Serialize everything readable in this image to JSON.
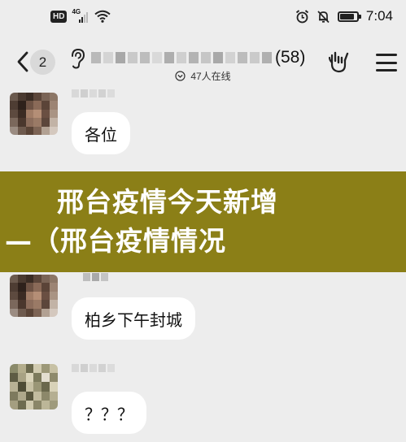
{
  "status_bar": {
    "hd_label": "HD",
    "network_label": "4G",
    "time": "7:04",
    "battery_level": 0.85,
    "icons": [
      "signal-icon",
      "wifi-icon",
      "alarm-icon",
      "silent-bell-icon",
      "battery-icon"
    ]
  },
  "nav": {
    "unread_count": "2",
    "group_member_count": "(58)",
    "online_text": "47人在线",
    "icons": [
      "back-arrow-icon",
      "ear-icon",
      "gesture-icon",
      "menu-icon"
    ]
  },
  "messages": [
    {
      "text": "各位"
    },
    {
      "text": "柏乡下午封城"
    },
    {
      "text": "？？？"
    }
  ],
  "banner": {
    "line1": "邢台疫情今天新增",
    "line2": "—（邢台疫情情况",
    "color": "#8b7f17"
  }
}
